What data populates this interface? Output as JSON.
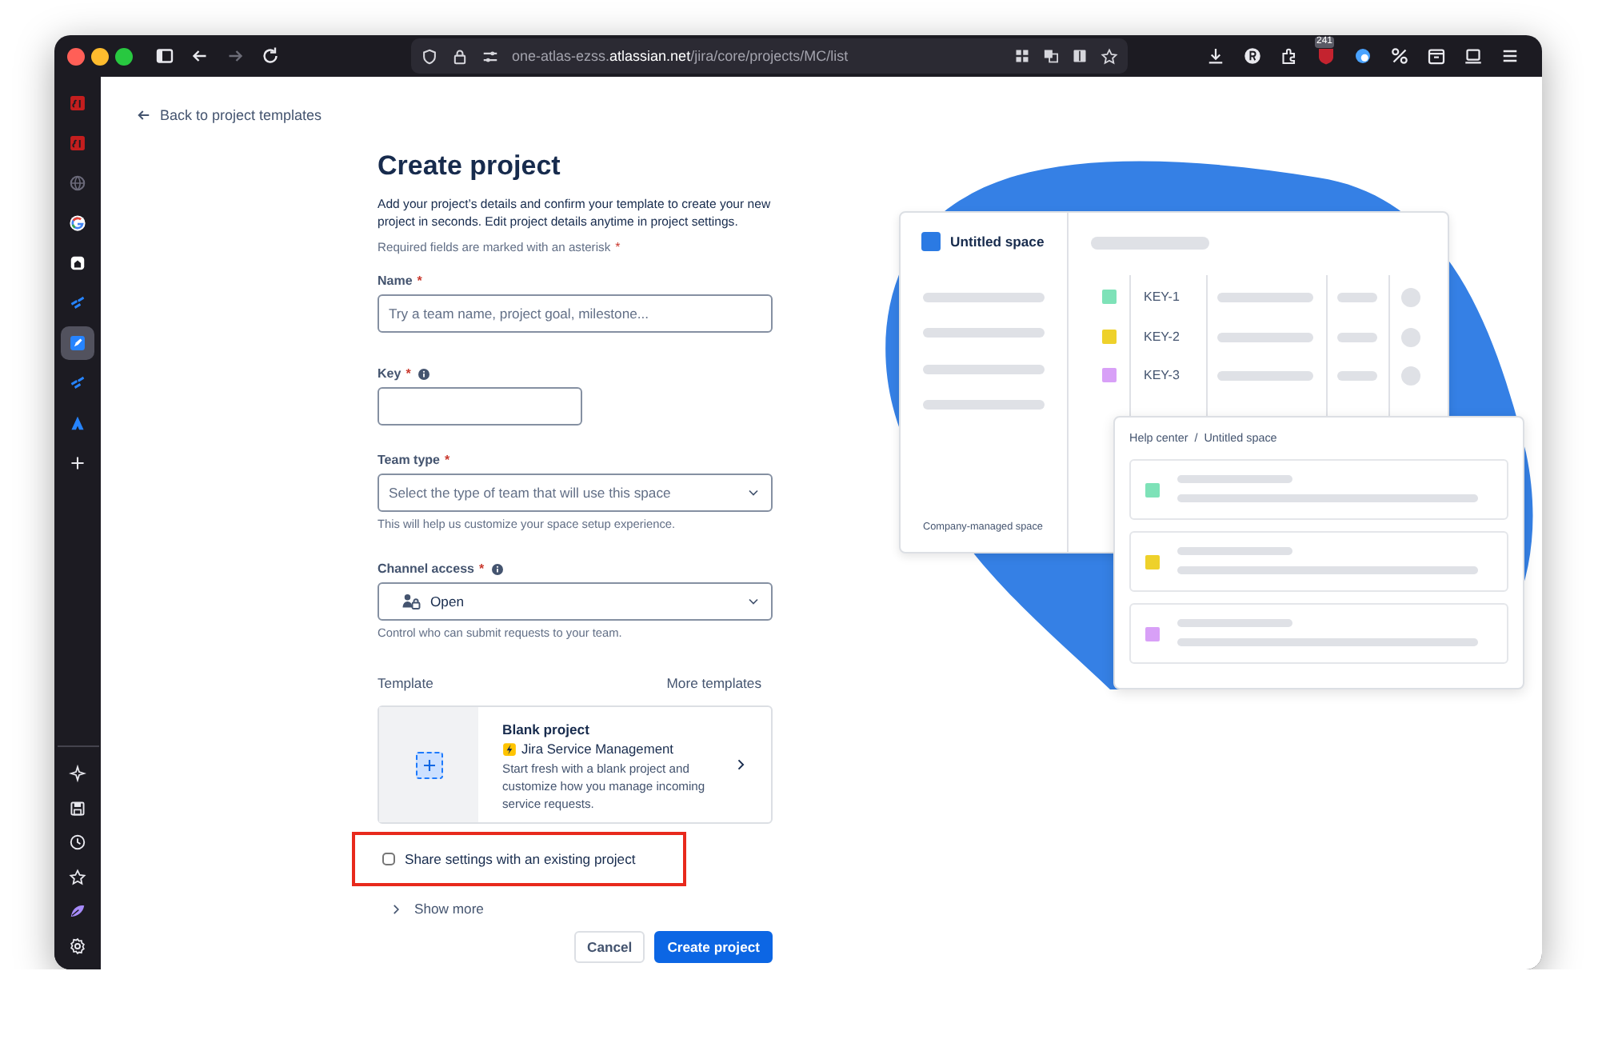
{
  "browser": {
    "url": "one-atlas-ezss.**atlassian.net**/jira/core/projects/MC/list",
    "forward_disabled": true,
    "badge": "241"
  },
  "sidebar": {
    "top_items": [
      {
        "kind": "logo",
        "selected": false
      },
      {
        "kind": "logo",
        "selected": false
      },
      {
        "kind": "globe",
        "selected": false
      },
      {
        "kind": "google",
        "selected": false
      },
      {
        "kind": "home",
        "selected": false
      },
      {
        "kind": "jira",
        "selected": false
      },
      {
        "kind": "rocket",
        "selected": true
      },
      {
        "kind": "jira",
        "selected": false
      },
      {
        "kind": "atlassian",
        "selected": false
      },
      {
        "kind": "plus",
        "selected": false
      }
    ],
    "bottom_items": [
      {
        "kind": "sparkle",
        "selected": false
      },
      {
        "kind": "save",
        "selected": false
      },
      {
        "kind": "clock",
        "selected": false
      },
      {
        "kind": "star",
        "selected": false
      },
      {
        "kind": "leaf",
        "selected": false
      },
      {
        "kind": "gear",
        "selected": false
      }
    ]
  },
  "back_link": "Back to project templates",
  "form": {
    "title": "Create project",
    "description": "Add your project’s details and confirm your template to create your new project in seconds. Edit project details anytime in project settings.",
    "required_note": "Required fields are marked with an asterisk",
    "required_mark": "*",
    "fields": [
      {
        "kind": "input",
        "label": "Name",
        "mark": "*",
        "placeholder": "Try a team name, project goal, milestone..."
      },
      {
        "kind": "short_input",
        "label": "Key",
        "mark": "*",
        "info": true
      },
      {
        "kind": "select",
        "label": "Team type",
        "mark": "*",
        "placeholder": "Select the type of team that will use this space",
        "help": "This will help us customize your space setup experience."
      },
      {
        "kind": "icon_select",
        "label": "Channel access",
        "mark": "*",
        "info": true,
        "value": "Open",
        "help": "Control who can submit requests to your team."
      }
    ],
    "template": {
      "label": "Template",
      "more_link": "More templates",
      "card": {
        "title": "Blank project",
        "product": "Jira Service Management",
        "description": "Start fresh with a blank project and customize how you manage incoming service requests."
      }
    },
    "share_checkbox": {
      "label": "Share settings with an existing project",
      "checked": false,
      "highlighted": true
    },
    "show_more": {
      "label": "Show more",
      "expanded": false
    },
    "buttons": [
      {
        "label": "Cancel",
        "kind": "secondary"
      },
      {
        "label": "Create project",
        "kind": "primary"
      }
    ]
  },
  "preview": {
    "space_card": {
      "title": "Untitled space",
      "footer": "Company-managed space",
      "issues": [
        {
          "key": "KEY-1",
          "color": "#7ee2b8"
        },
        {
          "key": "KEY-2",
          "color": "#eed12b"
        },
        {
          "key": "KEY-3",
          "color": "#d8a0f7"
        }
      ]
    },
    "help_card": {
      "breadcrumb": "Help center  /  Untitled space",
      "requests": [
        {
          "color": "#7ee2b8"
        },
        {
          "color": "#eed12b"
        },
        {
          "color": "#d8a0f7"
        }
      ]
    }
  }
}
